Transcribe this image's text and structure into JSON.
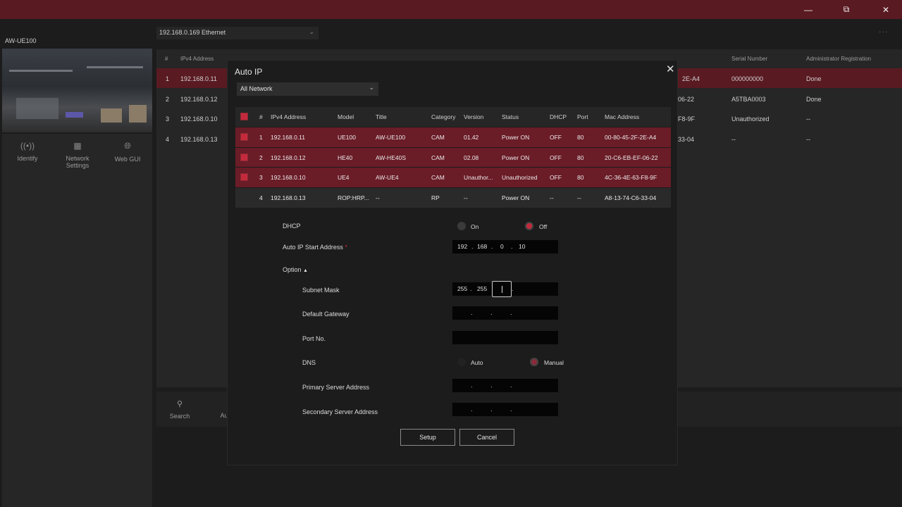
{
  "window": {
    "minimize_icon": "minimize-icon",
    "maximize_icon": "restore-icon",
    "close_icon": "close-icon"
  },
  "app": {
    "device_name": "AW-UE100",
    "network_select": "192.168.0.169 Ethernet",
    "tools": [
      {
        "label": "Identify",
        "icon": "identify-icon"
      },
      {
        "label": "Network Settings",
        "icon": "network-settings-icon"
      },
      {
        "label": "Web GUI",
        "icon": "web-gui-icon"
      }
    ],
    "bottom_tools": [
      {
        "label": "Search",
        "icon": "search-icon"
      },
      {
        "label": "Au",
        "icon": "auto-ip-icon"
      }
    ],
    "table_headers": [
      "#",
      "IPv4 Address",
      "Model",
      "Title",
      "Category",
      "Version",
      "Status",
      "DHCP",
      "Port",
      "Mac Address",
      "Serial Number",
      "Administrator Registration"
    ],
    "rows": [
      {
        "num": "1",
        "ip": "192.168.0.11",
        "mac_tail": "2E-A4",
        "serial": "000000000",
        "admin": "Done"
      },
      {
        "num": "2",
        "ip": "192.168.0.12",
        "mac_tail": "06-22",
        "serial": "A5TBA0003",
        "admin": "Done"
      },
      {
        "num": "3",
        "ip": "192.168.0.10",
        "mac_tail": "F8-9F",
        "serial": "Unauthorized",
        "admin": "--"
      },
      {
        "num": "4",
        "ip": "192.168.0.13",
        "mac_tail": "33-04",
        "serial": "--",
        "admin": "--"
      }
    ]
  },
  "dialog": {
    "title": "Auto IP",
    "network_select": "All Network",
    "headers": {
      "num": "#",
      "ip": "IPv4 Address",
      "model": "Model",
      "title": "Title",
      "category": "Category",
      "version": "Version",
      "status": "Status",
      "dhcp": "DHCP",
      "port": "Port",
      "mac": "Mac Address"
    },
    "rows": [
      {
        "num": "1",
        "ip": "192.168.0.11",
        "model": "UE100",
        "title": "AW-UE100",
        "category": "CAM",
        "version": "01.42",
        "status": "Power ON",
        "dhcp": "OFF",
        "port": "80",
        "mac": "00-80-45-2F-2E-A4",
        "checked": true
      },
      {
        "num": "2",
        "ip": "192.168.0.12",
        "model": "HE40",
        "title": "AW-HE40S",
        "category": "CAM",
        "version": "02.08",
        "status": "Power ON",
        "dhcp": "OFF",
        "port": "80",
        "mac": "20-C6-EB-EF-06-22",
        "checked": true
      },
      {
        "num": "3",
        "ip": "192.168.0.10",
        "model": "UE4",
        "title": "AW-UE4",
        "category": "CAM",
        "version": "Unauthor...",
        "status": "Unauthorized",
        "dhcp": "OFF",
        "port": "80",
        "mac": "4C-36-4E-63-F8-9F",
        "checked": true
      },
      {
        "num": "4",
        "ip": "192.168.0.13",
        "model": "ROP:HRP...",
        "title": "--",
        "category": "RP",
        "version": "--",
        "status": "Power ON",
        "dhcp": "--",
        "port": "--",
        "mac": "A8-13-74-C6-33-04",
        "checked": false
      }
    ],
    "dhcp": {
      "label": "DHCP",
      "on": "On",
      "off": "Off",
      "selected": "Off"
    },
    "start_address": {
      "label": "Auto IP Start Address",
      "required": "*",
      "octets": [
        "192",
        "168",
        "0",
        "10"
      ]
    },
    "option_label": "Option",
    "option_caret": "▲",
    "subnet_mask": {
      "label": "Subnet Mask",
      "octets": [
        "255",
        "255",
        "",
        ""
      ]
    },
    "default_gateway": {
      "label": "Default Gateway"
    },
    "port_no": {
      "label": "Port No."
    },
    "dns": {
      "label": "DNS",
      "auto": "Auto",
      "manual": "Manual",
      "selected": "Manual"
    },
    "primary_server": {
      "label": "Primary Server Address"
    },
    "secondary_server": {
      "label": "Secondary Server Address"
    },
    "setup_label": "Setup",
    "cancel_label": "Cancel"
  }
}
